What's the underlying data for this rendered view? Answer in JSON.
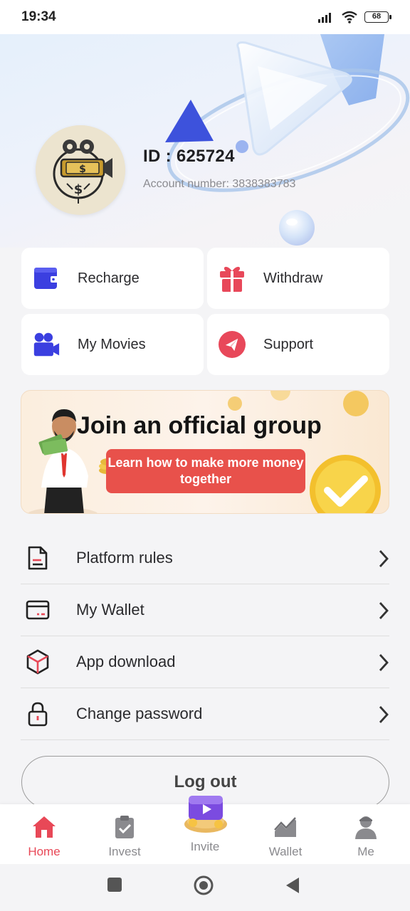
{
  "status_bar": {
    "time": "19:34",
    "battery": "68",
    "icons": [
      "signal-icon",
      "wifi-icon",
      "battery-icon"
    ]
  },
  "profile": {
    "id_label": "ID : 625724",
    "account_number": "Account number: 3838383783"
  },
  "quick_actions": [
    {
      "label": "Recharge",
      "icon": "wallet-icon",
      "color": "#3b3fe0"
    },
    {
      "label": "Withdraw",
      "icon": "gift-icon",
      "color": "#e8485a"
    },
    {
      "label": "My Movies",
      "icon": "video-camera-icon",
      "color": "#3b3fe0"
    },
    {
      "label": "Support",
      "icon": "paper-plane-icon",
      "color": "#e8485a"
    }
  ],
  "banner": {
    "title": "Join an official group",
    "cta": "Learn how to make more money together"
  },
  "menu": [
    {
      "label": "Platform rules",
      "icon": "document-icon"
    },
    {
      "label": "My Wallet",
      "icon": "card-icon"
    },
    {
      "label": "App download",
      "icon": "cube-icon"
    },
    {
      "label": "Change password",
      "icon": "lock-icon"
    }
  ],
  "logout_label": "Log out",
  "tabs": [
    {
      "label": "Home",
      "icon": "home-icon",
      "active": true
    },
    {
      "label": "Invest",
      "icon": "clipboard-check-icon",
      "active": false
    },
    {
      "label": "Invite",
      "icon": "gift-box-icon",
      "active": false
    },
    {
      "label": "Wallet",
      "icon": "chart-line-icon",
      "active": false
    },
    {
      "label": "Me",
      "icon": "person-icon",
      "active": false
    }
  ],
  "colors": {
    "accent": "#e84857",
    "primary_blue": "#3b3fe0",
    "banner_button": "#e8514b"
  }
}
